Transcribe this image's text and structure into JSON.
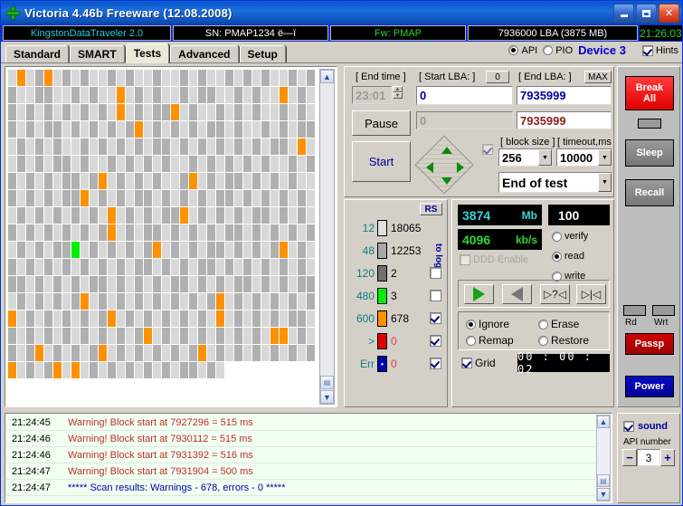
{
  "window": {
    "title": "Victoria 4.46b Freeware (12.08.2008)",
    "minimize": "_",
    "maximize": "□",
    "close": "✕"
  },
  "device_bar": {
    "model": "KingstonDataTraveler 2.0",
    "serial": "SN: PMAP1234    ё—ï",
    "firmware": "Fw: PMAP",
    "capacity": "7936000 LBA (3875 MB)",
    "clock": "21:26:03"
  },
  "tabs": [
    {
      "label": "Standard",
      "active": false
    },
    {
      "label": "SMART",
      "active": false
    },
    {
      "label": "Tests",
      "active": true
    },
    {
      "label": "Advanced",
      "active": false
    },
    {
      "label": "Setup",
      "active": false
    }
  ],
  "tab_controls": {
    "api_label": "API",
    "pio_label": "PIO",
    "device_label": "Device 3",
    "hints_label": "Hints",
    "api_selected": true,
    "hints_checked": true
  },
  "test_controls": {
    "end_time_label": "[ End time ]",
    "end_time_value": "23:01",
    "start_lba_label": "[ Start LBA: ]",
    "start_lba_zero_button": "0",
    "start_lba_value": "0",
    "start_lba_second_value": "0",
    "end_lba_label": "[ End LBA: ]",
    "end_lba_max_button": "MAX",
    "end_lba_value": "7935999",
    "end_lba_second_value": "7935999",
    "pause_button": "Pause",
    "start_button": "Start",
    "block_size_label": "[ block size ]",
    "block_size_value": "256",
    "timeout_label": "[ timeout,ms ]",
    "timeout_value": "10000",
    "end_of_test_value": "End of test"
  },
  "legend": {
    "rs_button": "RS",
    "to_log_label": "to log:",
    "rows": [
      {
        "threshold": "12",
        "color": "#e0e0e0",
        "count": "18065",
        "logged": null
      },
      {
        "threshold": "48",
        "color": "#a8a8a8",
        "count": "12253",
        "logged": null
      },
      {
        "threshold": "120",
        "color": "#707070",
        "count": "2",
        "logged": false
      },
      {
        "threshold": "480",
        "color": "#00ee00",
        "count": "3",
        "logged": false
      },
      {
        "threshold": "600",
        "color": "#ff9000",
        "count": "678",
        "logged": true
      },
      {
        "threshold": ">",
        "color": "#e00000",
        "count": "0",
        "logged": true
      },
      {
        "threshold": "Err",
        "color": "#0000cc",
        "count": "0",
        "logged": true
      }
    ]
  },
  "stats": {
    "size_value": "3874",
    "size_unit": "Mb",
    "percent_value": "100",
    "percent_unit": "%",
    "speed_value": "4096",
    "speed_unit": "kb/s",
    "ddd_enable_label": "DDD Enable",
    "ddd_enabled": false,
    "modes": [
      {
        "label": "verify",
        "selected": false
      },
      {
        "label": "read",
        "selected": true
      },
      {
        "label": "write",
        "selected": false
      }
    ],
    "nav_buttons": [
      {
        "name": "play",
        "glyph": "▶"
      },
      {
        "name": "rewind",
        "glyph": "◀"
      },
      {
        "name": "seek-query",
        "glyph": "▷?◁"
      },
      {
        "name": "seek-end",
        "glyph": "▷|◁"
      }
    ],
    "defect_actions": [
      {
        "label": "Ignore",
        "selected": true
      },
      {
        "label": "Erase",
        "selected": false
      },
      {
        "label": "Remap",
        "selected": false
      },
      {
        "label": "Restore",
        "selected": false
      }
    ],
    "grid_label": "Grid",
    "grid_checked": true,
    "timer": "00 : 00 : 02"
  },
  "right_buttons": {
    "break_all": "Break\nAll",
    "break_all_line1": "Break",
    "break_all_line2": "All",
    "sleep": "Sleep",
    "recall": "Recall",
    "rd_label": "Rd",
    "wrt_label": "Wrt",
    "passp": "Passp",
    "power": "Power"
  },
  "log": {
    "entries": [
      {
        "time": "21:24:45",
        "text": "Warning! Block start at 7927296 = 515 ms",
        "type": "warn"
      },
      {
        "time": "21:24:46",
        "text": "Warning! Block start at 7930112 = 515 ms",
        "type": "warn"
      },
      {
        "time": "21:24:46",
        "text": "Warning! Block start at 7931392 = 516 ms",
        "type": "warn"
      },
      {
        "time": "21:24:47",
        "text": "Warning! Block start at 7931904 = 500 ms",
        "type": "warn"
      },
      {
        "time": "21:24:47",
        "text": "***** Scan results: Warnings - 678, errors - 0 *****",
        "type": "info"
      }
    ]
  },
  "footer": {
    "sound_label": "sound",
    "sound_checked": true,
    "api_number_label": "API number",
    "api_number_minus": "−",
    "api_number_value": "3",
    "api_number_plus": "+"
  },
  "surface_map": {
    "colors": {
      "light": "#d8d8d8",
      "mid": "#b0b0b0",
      "warn": "#ff9000",
      "good": "#00ee00",
      "empty": "#ffffff"
    },
    "cols": 34,
    "rows": 20,
    "rows_data": [
      [
        0,
        2,
        0,
        1,
        2,
        0,
        1,
        0,
        1,
        0,
        0,
        1,
        0,
        1,
        0,
        0,
        1,
        0,
        0,
        1,
        0,
        1,
        0,
        0,
        1,
        0,
        1,
        0,
        1,
        0,
        0,
        1,
        0,
        1
      ],
      [
        1,
        0,
        0,
        1,
        1,
        0,
        0,
        1,
        0,
        1,
        0,
        0,
        2,
        0,
        1,
        0,
        1,
        0,
        0,
        1,
        0,
        1,
        1,
        0,
        0,
        1,
        0,
        1,
        0,
        0,
        2,
        0,
        1,
        0
      ],
      [
        1,
        0,
        1,
        0,
        1,
        0,
        1,
        0,
        1,
        0,
        1,
        0,
        2,
        0,
        1,
        0,
        1,
        1,
        2,
        0,
        1,
        0,
        0,
        1,
        0,
        1,
        0,
        1,
        0,
        0,
        1,
        0,
        1,
        0
      ],
      [
        1,
        0,
        1,
        0,
        1,
        1,
        0,
        1,
        0,
        1,
        0,
        1,
        0,
        1,
        2,
        0,
        1,
        0,
        1,
        0,
        1,
        0,
        1,
        1,
        0,
        1,
        0,
        0,
        1,
        0,
        1,
        0,
        1,
        1
      ],
      [
        0,
        1,
        0,
        1,
        0,
        1,
        0,
        0,
        1,
        0,
        1,
        0,
        1,
        0,
        1,
        0,
        1,
        1,
        0,
        1,
        0,
        1,
        0,
        1,
        0,
        1,
        0,
        1,
        0,
        1,
        1,
        0,
        2,
        0
      ],
      [
        0,
        1,
        0,
        1,
        0,
        1,
        1,
        0,
        1,
        0,
        0,
        1,
        0,
        1,
        0,
        1,
        0,
        1,
        0,
        0,
        1,
        0,
        1,
        0,
        1,
        0,
        1,
        0,
        1,
        0,
        0,
        1,
        0,
        1
      ],
      [
        1,
        0,
        1,
        0,
        1,
        0,
        1,
        1,
        0,
        1,
        2,
        0,
        1,
        0,
        1,
        0,
        1,
        0,
        0,
        1,
        2,
        0,
        1,
        0,
        1,
        1,
        0,
        1,
        0,
        1,
        0,
        1,
        0,
        0
      ],
      [
        1,
        0,
        1,
        0,
        1,
        0,
        1,
        1,
        2,
        0,
        1,
        0,
        1,
        0,
        1,
        1,
        0,
        1,
        0,
        1,
        0,
        1,
        0,
        1,
        1,
        0,
        1,
        0,
        1,
        0,
        1,
        0,
        1,
        0
      ],
      [
        0,
        1,
        0,
        1,
        0,
        1,
        0,
        1,
        0,
        1,
        0,
        2,
        0,
        1,
        0,
        1,
        0,
        1,
        1,
        2,
        0,
        1,
        0,
        1,
        0,
        1,
        0,
        1,
        1,
        0,
        1,
        0,
        1,
        0
      ],
      [
        1,
        0,
        1,
        0,
        1,
        0,
        1,
        0,
        1,
        0,
        1,
        2,
        0,
        1,
        0,
        1,
        1,
        0,
        1,
        0,
        1,
        0,
        1,
        0,
        1,
        1,
        0,
        1,
        0,
        1,
        0,
        1,
        0,
        1
      ],
      [
        0,
        1,
        0,
        1,
        0,
        1,
        1,
        3,
        0,
        1,
        0,
        1,
        0,
        1,
        0,
        1,
        2,
        0,
        1,
        0,
        1,
        0,
        1,
        1,
        0,
        1,
        0,
        1,
        0,
        1,
        2,
        0,
        1,
        0
      ],
      [
        1,
        0,
        1,
        0,
        1,
        0,
        1,
        0,
        1,
        0,
        1,
        0,
        1,
        0,
        1,
        1,
        0,
        1,
        0,
        1,
        0,
        1,
        1,
        0,
        1,
        0,
        1,
        0,
        1,
        0,
        1,
        0,
        1,
        0
      ],
      [
        1,
        1,
        0,
        1,
        0,
        1,
        0,
        1,
        0,
        1,
        1,
        0,
        1,
        0,
        1,
        0,
        1,
        0,
        1,
        1,
        0,
        1,
        0,
        1,
        0,
        1,
        1,
        0,
        1,
        0,
        1,
        0,
        1,
        1
      ],
      [
        0,
        1,
        0,
        1,
        0,
        1,
        0,
        1,
        2,
        0,
        1,
        0,
        1,
        0,
        1,
        0,
        1,
        0,
        1,
        0,
        1,
        0,
        1,
        2,
        0,
        1,
        0,
        1,
        0,
        1,
        0,
        1,
        0,
        1
      ],
      [
        2,
        0,
        1,
        0,
        1,
        0,
        1,
        0,
        1,
        0,
        1,
        2,
        0,
        1,
        0,
        1,
        0,
        1,
        0,
        1,
        0,
        1,
        0,
        2,
        0,
        1,
        0,
        1,
        0,
        1,
        0,
        1,
        1,
        0
      ],
      [
        1,
        0,
        1,
        0,
        1,
        0,
        1,
        0,
        1,
        0,
        1,
        0,
        1,
        0,
        1,
        2,
        0,
        1,
        0,
        1,
        0,
        1,
        0,
        1,
        0,
        1,
        0,
        1,
        0,
        2,
        2,
        0,
        1,
        0
      ],
      [
        1,
        0,
        1,
        2,
        0,
        1,
        0,
        1,
        0,
        1,
        2,
        0,
        1,
        0,
        1,
        0,
        1,
        0,
        1,
        0,
        1,
        2,
        0,
        1,
        0,
        1,
        0,
        1,
        0,
        1,
        0,
        1,
        0,
        1
      ],
      [
        2,
        0,
        1,
        0,
        1,
        2,
        0,
        2,
        0,
        1,
        0,
        1,
        0,
        1,
        0,
        1,
        0,
        1,
        0,
        1,
        1,
        0,
        1,
        0,
        9,
        9,
        9,
        9,
        9,
        9,
        9,
        9,
        9,
        9
      ]
    ]
  }
}
